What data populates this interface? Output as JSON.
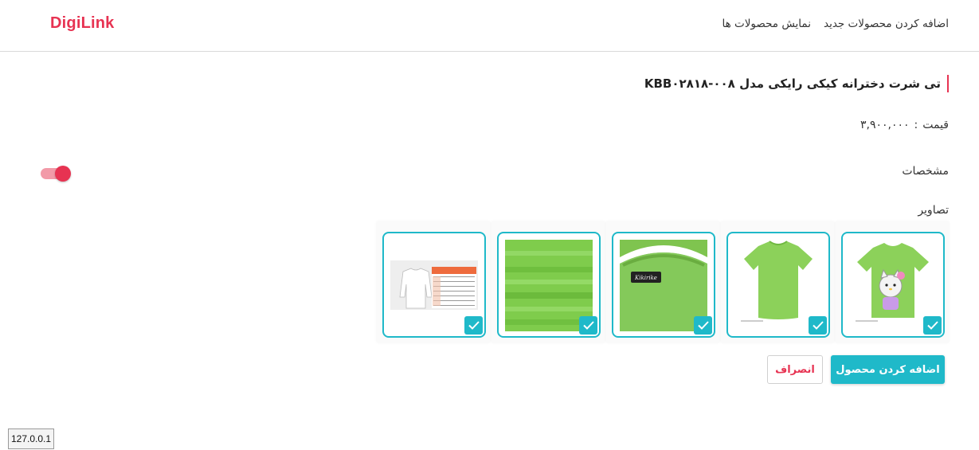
{
  "brand": {
    "name": "DigiLink",
    "color": "#e73352"
  },
  "nav": {
    "items": [
      {
        "label": "اضافه کردن محصولات جدید"
      },
      {
        "label": "نمایش محصولات ها"
      }
    ]
  },
  "product": {
    "title": "تی شرت دخترانه کیکی رایکی مدل KBB۰۲۸۱۸-۰۰۸",
    "price_label": "قیمت",
    "price_separator": ":",
    "price_value": "۳,۹۰۰,۰۰۰"
  },
  "specs": {
    "label": "مشخصات",
    "toggle_on": true
  },
  "images": {
    "label": "تصاویر",
    "items": [
      {
        "icon": "tshirt-hello-kitty-image",
        "selected": true
      },
      {
        "icon": "tshirt-plain-image",
        "selected": true
      },
      {
        "icon": "tshirt-collar-label-image",
        "selected": true
      },
      {
        "icon": "fabric-texture-image",
        "selected": true
      },
      {
        "icon": "size-chart-image",
        "selected": true
      }
    ]
  },
  "actions": {
    "add_label": "اضافه کردن محصول",
    "cancel_label": "انصراف"
  },
  "status": {
    "host": "127.0.0.1"
  },
  "colors": {
    "accent": "#1fb9c9",
    "brand": "#e73352",
    "shirt": "#8cd15a"
  }
}
